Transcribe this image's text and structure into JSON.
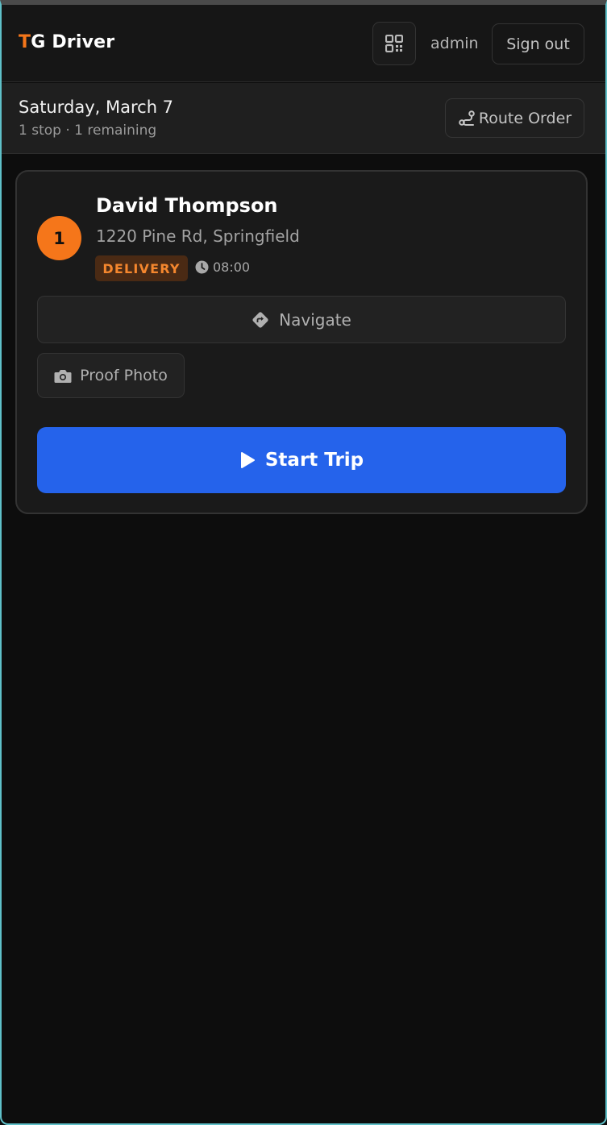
{
  "header": {
    "brand_accent": "T",
    "brand_rest": "G Driver",
    "qr_icon": "qr-code-icon",
    "user": "admin",
    "signout_label": "Sign out"
  },
  "day": {
    "date": "Saturday, March 7",
    "summary": "1 stop · 1 remaining",
    "route_icon": "route-icon",
    "route_label": "Route Order"
  },
  "stops": [
    {
      "number": "1",
      "name": "David Thompson",
      "address": "1220 Pine Rd, Springfield",
      "type": "DELIVERY",
      "time_icon": "clock-icon",
      "time": "08:00",
      "navigate_icon": "directions-icon",
      "navigate_label": "Navigate",
      "proof_icon": "camera-icon",
      "proof_label": "Proof Photo",
      "start_icon": "play-icon",
      "start_label": "Start Trip"
    }
  ],
  "colors": {
    "accent": "#f5761a",
    "primary_button": "#2563eb",
    "background": "#0d0d0d",
    "card": "#1a1a1a"
  }
}
